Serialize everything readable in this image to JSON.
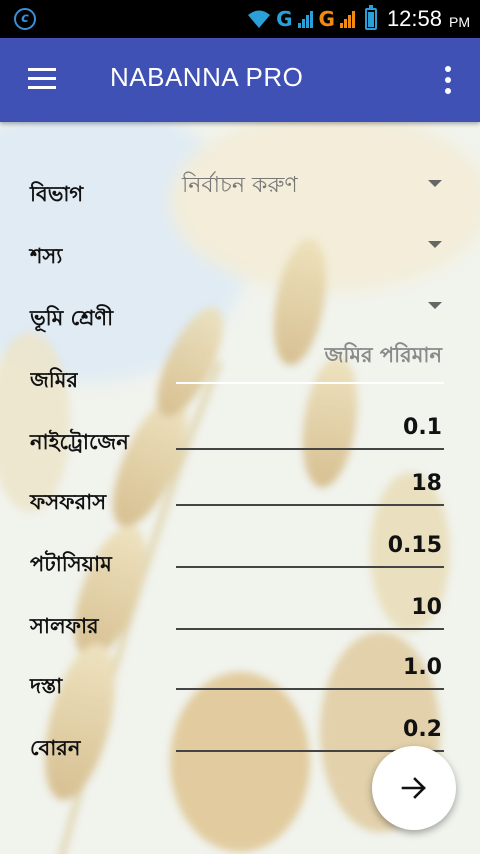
{
  "status_bar": {
    "time": "12:58",
    "ampm": "PM",
    "net1": "G",
    "net2": "G"
  },
  "toolbar": {
    "title": "NABANNA PRO",
    "menu_icon": "hamburger-menu-icon",
    "overflow_icon": "more-vertical-icon"
  },
  "form": {
    "division": {
      "label": "বিভাগ",
      "selected": "নির্বাচন করুণ"
    },
    "crop": {
      "label": "শস্য",
      "selected": ""
    },
    "land_class": {
      "label": "ভূমি শ্রেণী",
      "selected": ""
    },
    "land_amount": {
      "label": "জমির",
      "placeholder": "জমির পরিমান",
      "value": ""
    },
    "nitrogen": {
      "label": "নাইট্রোজেন",
      "value": "0.1"
    },
    "phosphorus": {
      "label": "ফসফরাস",
      "value": "18"
    },
    "potassium": {
      "label": "পটাসিয়াম",
      "value": "0.15"
    },
    "sulfur": {
      "label": "সালফার",
      "value": "10"
    },
    "zinc": {
      "label": "দস্তা",
      "value": "1.0"
    },
    "boron": {
      "label": "বোরন",
      "value": "0.2"
    }
  },
  "fab": {
    "icon": "arrow-right-icon"
  },
  "colors": {
    "toolbar": "#3f51b5",
    "status_bar": "#000000"
  }
}
